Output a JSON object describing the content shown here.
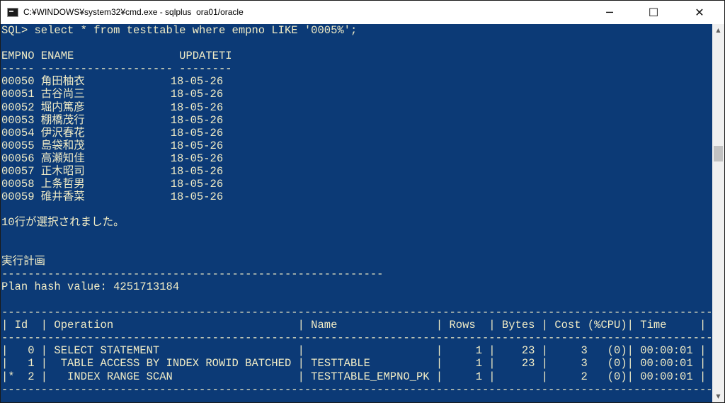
{
  "window": {
    "title": "C:¥WINDOWS¥system32¥cmd.exe - sqlplus  ora01/oracle",
    "icon": "console-app-icon",
    "controls": {
      "minimize": "─",
      "maximize": "☐",
      "close": "✕"
    }
  },
  "console": {
    "colors": {
      "background": "#0c3a76",
      "text": "#f1ecc6"
    },
    "lines": [
      "SQL> select * from testtable where empno LIKE '0005%';",
      "",
      "EMPNO ENAME                UPDATETI",
      "----- -------------------- --------",
      "00050 角田柚衣             18-05-26",
      "00051 古谷尚三             18-05-26",
      "00052 堀内篤彦             18-05-26",
      "00053 棚橋茂行             18-05-26",
      "00054 伊沢春花             18-05-26",
      "00055 島袋和茂             18-05-26",
      "00056 高瀬知佳             18-05-26",
      "00057 正木昭司             18-05-26",
      "00058 上条哲男             18-05-26",
      "00059 碓井香菜             18-05-26",
      "",
      "10行が選択されました。",
      "",
      "",
      "実行計画",
      "----------------------------------------------------------",
      "Plan hash value: 4251713184",
      "",
      "------------------------------------------------------------------------------------------------------------",
      "| Id  | Operation                            | Name               | Rows  | Bytes | Cost (%CPU)| Time     |",
      "------------------------------------------------------------------------------------------------------------",
      "|   0 | SELECT STATEMENT                     |                    |     1 |    23 |     3   (0)| 00:00:01 |",
      "|   1 |  TABLE ACCESS BY INDEX ROWID BATCHED | TESTTABLE          |     1 |    23 |     3   (0)| 00:00:01 |",
      "|*  2 |   INDEX RANGE SCAN                   | TESTTABLE_EMPNO_PK |     1 |       |     2   (0)| 00:00:01 |",
      "------------------------------------------------------------------------------------------------------------"
    ]
  },
  "scrollbar": {
    "up_icon": "▲",
    "down_icon": "▼"
  }
}
